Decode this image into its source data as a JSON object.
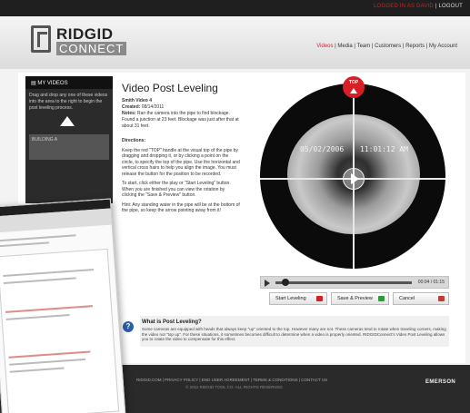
{
  "topbar": {
    "login_prefix": "",
    "login_user": "LOGGED IN AS DAVID",
    "login_sep": " | ",
    "logout": "LOGOUT"
  },
  "brand": {
    "ridgid": "RIDGID",
    "connect": "CONNECT"
  },
  "nav": {
    "items": [
      "Videos",
      "Media",
      "Team",
      "Customers",
      "Reports",
      "My Account"
    ],
    "active": "Videos"
  },
  "sidebar": {
    "heading": "MY VIDEOS",
    "instructions": "Drag and drop any one of these videos into the area to the right to begin the post leveling process.",
    "thumb_label": "BUILDING A"
  },
  "content": {
    "title": "Video Post Leveling",
    "video_name_label": "Smith Video 4",
    "created_label": "Created:",
    "created_value": "08/14/2011",
    "notes_label": "Notes:",
    "notes_value": "Ran the camera into the pipe to find blockage. Found a junction at 23 feet. Blockage was just after that at about 31 feet.",
    "directions_heading": "Directions:",
    "directions": [
      "Keep the red \"TOP\" handle at the visual top of the pipe by dragging and dropping it, or by clicking a point on the circle, to specify the top of the pipe. Use the horizontal and vertical cross hairs to help you align the image. You must release the button for the position to be recorded.",
      "To start, click either the play or \"Start Leveling\" button. When you are finished you can view the rotation by clicking the \"Save & Preview\" button.",
      "Hint: Any standing water in the pipe will be at the bottom of the pipe, so keep the arrow pointing away from it!"
    ]
  },
  "scope": {
    "top_label": "TOP",
    "date_overlay": "05/02/2006",
    "time_overlay": "11:01:12 AM"
  },
  "player": {
    "time": "00:04 / 01:15",
    "progress": 0.07
  },
  "buttons": {
    "start": "Start Leveling",
    "save": "Save & Preview",
    "cancel": "Cancel"
  },
  "colors": {
    "brand_red": "#d61f26",
    "start_sq": "#d61f26",
    "save_sq": "#2e9b3a",
    "cancel_sq": "#c23a3a"
  },
  "info": {
    "icon": "?",
    "title": "What is Post Leveling?",
    "text": "Some cameras are equipped with heads that always keep \"up\" oriented to the top. However many are not. These cameras tend to rotate when traveling corners, making the video not \"top up\". For these situations, it sometimes becomes difficult to determine when a video is properly oriented. RIDGIDConnect's Video Post Leveling allows you to rotate the video to compensate for this effect."
  },
  "footer": {
    "links": "RIDGID.COM  |  PRIVACY POLICY  |  END USER AGREEMENT  |  TERMS & CONDITIONS  |  CONTACT US",
    "copyright": "© 2011 RIDGID TOOL CO. ALL RIGHTS RESERVED",
    "logo": "EMERSON"
  }
}
